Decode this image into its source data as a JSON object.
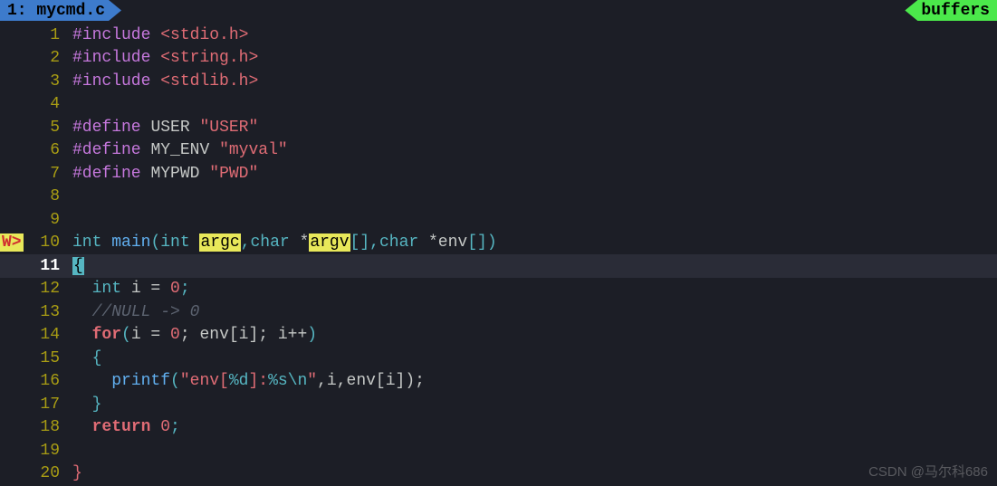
{
  "tabs": {
    "left": "1: mycmd.c",
    "right": "buffers"
  },
  "gutter": {
    "warning": "W>"
  },
  "lines": {
    "l1": {
      "num": "1",
      "include": "#include",
      "header": "<stdio.h>"
    },
    "l2": {
      "num": "2",
      "include": "#include",
      "header": "<string.h>"
    },
    "l3": {
      "num": "3",
      "include": "#include",
      "header": "<stdlib.h>"
    },
    "l4": {
      "num": "4"
    },
    "l5": {
      "num": "5",
      "define": "#define",
      "name": "USER",
      "value": "\"USER\""
    },
    "l6": {
      "num": "6",
      "define": "#define",
      "name": "MY_ENV",
      "value": "\"myval\""
    },
    "l7": {
      "num": "7",
      "define": "#define",
      "name": "MYPWD",
      "value": "\"PWD\""
    },
    "l8": {
      "num": "8"
    },
    "l9": {
      "num": "9"
    },
    "l10": {
      "num": "10",
      "type_int": "int",
      "main": "main",
      "p_open": "(",
      "arg1_type": "int",
      "arg1_name": "argc",
      "comma1": ",",
      "arg2_type": "char",
      "arg2_star": " *",
      "arg2_name": "argv",
      "arg2_brackets": "[]",
      "comma2": ",",
      "arg3_type": "char",
      "arg3_star": " *",
      "arg3_name": "env",
      "arg3_brackets": "[]",
      "p_close": ")"
    },
    "l11": {
      "num": "11",
      "brace": "{"
    },
    "l12": {
      "num": "12",
      "indent": "  ",
      "type": "int",
      "rest": " i = ",
      "zero": "0",
      "semi": ";"
    },
    "l13": {
      "num": "13",
      "indent": "  ",
      "comment": "//NULL -> 0"
    },
    "l14": {
      "num": "14",
      "indent": "  ",
      "for": "for",
      "open": "(",
      "body": "i = ",
      "zero": "0",
      "sep1": "; env[i]; i++",
      "close": ")"
    },
    "l15": {
      "num": "15",
      "indent": "  ",
      "brace": "{"
    },
    "l16": {
      "num": "16",
      "indent": "    ",
      "func": "printf",
      "open": "(",
      "str": "\"env[",
      "esc1": "%d",
      "str2": "]:",
      "esc2": "%s",
      "esc3": "\\n",
      "str3": "\"",
      "rest": ",i,env[i]);"
    },
    "l17": {
      "num": "17",
      "indent": "  ",
      "brace": "}"
    },
    "l18": {
      "num": "18",
      "indent": "  ",
      "return": "return",
      "sp": " ",
      "zero": "0",
      "semi": ";"
    },
    "l19": {
      "num": "19"
    },
    "l20": {
      "num": "20",
      "brace": "}"
    }
  },
  "watermark": "CSDN @马尔科686"
}
